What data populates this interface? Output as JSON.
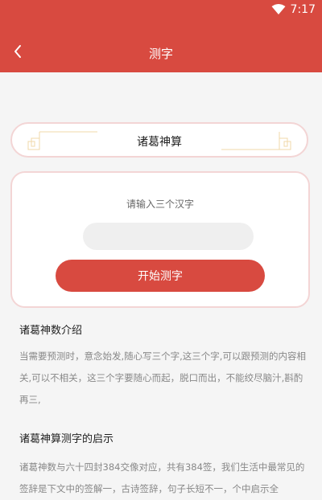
{
  "status": {
    "time": "7:17"
  },
  "header": {
    "title": "测字"
  },
  "banner": {
    "title": "诸葛神算"
  },
  "card": {
    "prompt": "请输入三个汉字",
    "input_value": "",
    "button_label": "开始测字"
  },
  "intro": {
    "title": "诸葛神数介绍",
    "text": "当需要预测时，意念始发,随心写三个字,这三个字,可以跟预测的内容相关,可以不相关，这三个字要随心而起，脱口而出，不能绞尽脑汁,斟酌再三,"
  },
  "revelation": {
    "title": "诸葛神算测字的启示",
    "text": "诸葛神数与六十四封384交像对应，共有384签，我们生活中最常见的签辞是下文中的签解一，古诗签辞，句子长短不一，个中启示全"
  },
  "colors": {
    "brand": "#d84a40",
    "border": "#f3d5d5",
    "background": "#f5f5f5"
  }
}
